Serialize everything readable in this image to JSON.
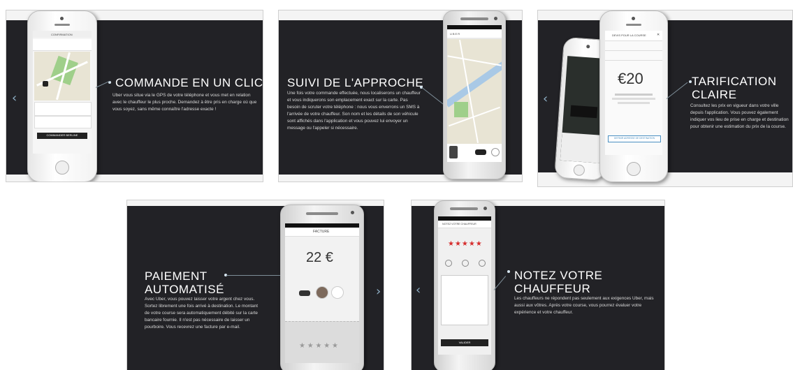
{
  "slides": [
    {
      "title": "COMMANDE EN UN CLIC",
      "description": "Uber vous situe via le GPS de votre téléphone et vous met en relation avec le chauffeur le plus proche. Demandez à être pris en charge où que vous soyez, sans même connaître l'adresse exacte !",
      "screen": {
        "header": "CONFIRMATION",
        "button": "COMMANDER BERLINE"
      }
    },
    {
      "title": "SUIVI DE L'APPROCHE",
      "description": "Une fois votre commande effectuée, nous localiserons un chauffeur et vous indiquerons son emplacement exact sur la carte. Pas besoin de scruter votre téléphone : nous vous enverrons un SMS à l'arrivée de votre chauffeur. Son nom et les détails de son véhicule sont affichés dans l'application et vous pouvez lui envoyer un message ou l'appeler si nécessaire.",
      "screen": {
        "header": "UBER"
      }
    },
    {
      "title": "TARIFICATION CLAIRE",
      "description": "Consultez les prix en vigueur dans votre ville depuis l'application. Vous pouvez également indiquer vos lieu de prise en charge et destination pour obtenir une estimation du prix de la course.",
      "screen": {
        "header": "DEVIS POUR LA COURSE",
        "price": "€20",
        "button": "DEFINIR ADRESSE DE DESTINATION"
      }
    },
    {
      "title": "PAIEMENT AUTOMATISÉ",
      "description": "Avec Uber, vous pouvez laisser votre argent chez vous. Sortez librement une fois arrivé à destination. Le montant de votre course sera automatiquement débité sur la carte bancaire fournie. Il n'est pas nécessaire de laisser un pourboire. Vous recevrez une facture par e-mail.",
      "screen": {
        "header": "FACTURE",
        "price": "22 €",
        "stars": "★ ★ ★ ★ ★"
      }
    },
    {
      "title": "NOTEZ VOTRE CHAUFFEUR",
      "description": "Les chauffeurs ne répondent pas seulement aux exigences Uber, mais aussi aux vôtres. Après votre course, vous pourrez évaluer votre expérience et votre chauffeur.",
      "screen": {
        "header": "NOTEZ VOTRE CHAUFFEUR",
        "stars": "★★★★★",
        "button": "VALIDER"
      }
    }
  ],
  "nav": {
    "prev": "‹",
    "next": "›"
  }
}
